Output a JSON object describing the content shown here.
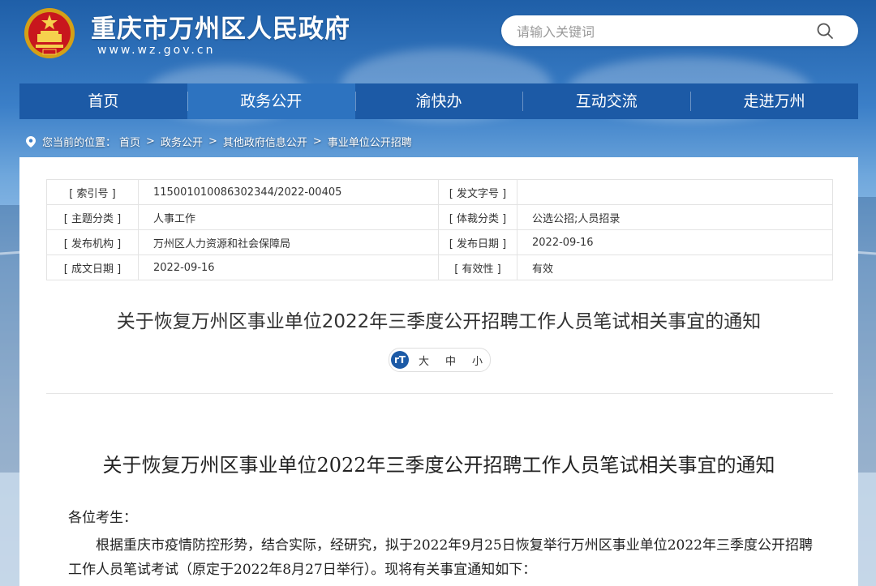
{
  "header": {
    "site_title": "重庆市万州区人民政府",
    "site_url": "www.wz.gov.cn"
  },
  "search": {
    "placeholder": "请输入关键词"
  },
  "nav": {
    "items": [
      "首页",
      "政务公开",
      "渝快办",
      "互动交流",
      "走进万州"
    ],
    "active_index": 1
  },
  "breadcrumb": {
    "prefix": "您当前的位置：",
    "items": [
      "首页",
      "政务公开",
      "其他政府信息公开",
      "事业单位公开招聘"
    ],
    "separator": ">"
  },
  "info": {
    "index_no_label": "[ 索引号 ]",
    "index_no": "11500101008630234​4/2022-00405",
    "doc_no_label": "[ 发文字号 ]",
    "doc_no": "",
    "topic_label": "[ 主题分类 ]",
    "topic": "人事工作",
    "genre_label": "[ 体裁分类 ]",
    "genre": "公选公招;人员招录",
    "issuer_label": "[ 发布机构 ]",
    "issuer": "万州区人力资源和社会保障局",
    "publish_date_label": "[ 发布日期 ]",
    "publish_date": "2022-09-16",
    "created_label": "[ 成文日期 ]",
    "created": "2022-09-16",
    "validity_label": "[ 有效性 ]",
    "validity": "有效"
  },
  "document": {
    "title": "关于恢复万州区事业单位2022年三季度公开招聘工作人员笔试相关事宜的通知",
    "body_title": "关于恢复万州区事业单位2022年三季度公开招聘工作人员笔试相关事宜的通知",
    "salutation": "各位考生：",
    "paragraph_1": "根据重庆市疫情防控形势，结合实际，经研究，拟于2022年9月25日恢复举行万州区事业单位2022年三季度公开招聘工作人员笔试考试（原定于2022年8月27日举行）。现将有关事宜通知如下："
  },
  "font_size": {
    "icon_label": "rT",
    "options": [
      "大",
      "中",
      "小"
    ]
  },
  "colors": {
    "primary": "#1c5aa6",
    "nav_active": "#2d73c0"
  }
}
